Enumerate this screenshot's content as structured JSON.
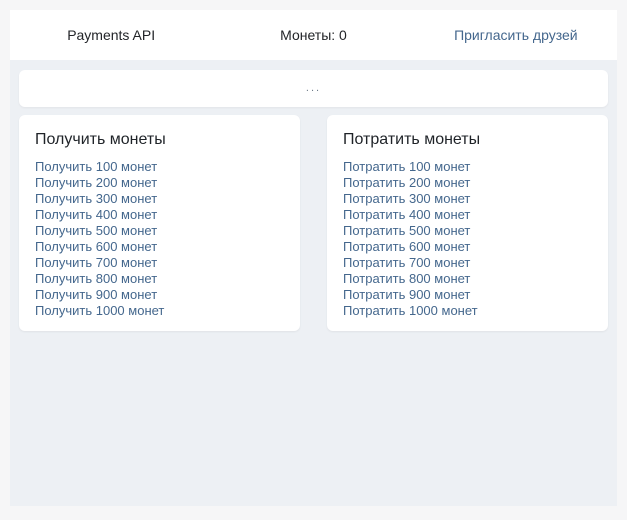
{
  "header": {
    "app_title": "Payments API",
    "coins_label": "Монеты:",
    "coins_value": "0",
    "invite_link": "Пригласить друзей"
  },
  "loader": {
    "text": "..."
  },
  "cards": [
    {
      "title": "Получить монеты",
      "links": [
        "Получить 100 монет",
        "Получить 200 монет",
        "Получить 300 монет",
        "Получить 400 монет",
        "Получить 500 монет",
        "Получить 600 монет",
        "Получить 700 монет",
        "Получить 800 монет",
        "Получить 900 монет",
        "Получить 1000 монет"
      ]
    },
    {
      "title": "Потратить монеты",
      "links": [
        "Потратить 100 монет",
        "Потратить 200 монет",
        "Потратить 300 монет",
        "Потратить 400 монет",
        "Потратить 500 монет",
        "Потратить 600 монет",
        "Потратить 700 монет",
        "Потратить 800 монет",
        "Потратить 900 монет",
        "Потратить 1000 монет"
      ]
    }
  ],
  "colors": {
    "page_background": "#f6f6f7",
    "panel_background": "#edf0f4",
    "card_background": "#ffffff",
    "link": "#44678d",
    "text": "#222428"
  }
}
